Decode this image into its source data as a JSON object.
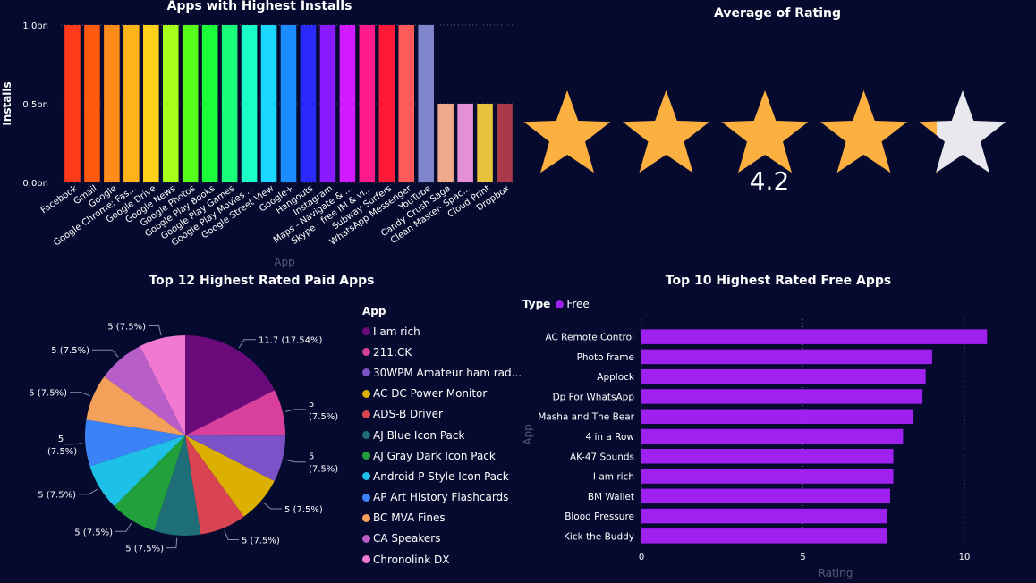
{
  "installs_chart": {
    "title": "Apps with Highest Installs",
    "xlabel": "App",
    "ylabel": "Installs",
    "ticks": [
      "0.0bn",
      "0.5bn",
      "1.0bn"
    ]
  },
  "rating_card": {
    "title": "Average of Rating",
    "value": "4.2"
  },
  "paid_chart": {
    "title": "Top 12 Highest Rated Paid Apps",
    "legend_title": "App"
  },
  "free_chart": {
    "title": "Top 10 Highest Rated Free Apps",
    "legend_label": "Type",
    "legend_entry": "Free",
    "ylabel": "App",
    "xlabel": "Rating",
    "ticks": [
      "0",
      "5",
      "10"
    ]
  },
  "chart_data": [
    {
      "type": "bar",
      "title": "Apps with Highest Installs",
      "xlabel": "App",
      "ylabel": "Installs",
      "ylim": [
        0,
        1.0
      ],
      "unit": "bn",
      "categories": [
        "Facebook",
        "Gmail",
        "Google",
        "Google Chrome: Fas...",
        "Google Drive",
        "Google News",
        "Google Photos",
        "Google Play Books",
        "Google Play Games",
        "Google Play Movies ...",
        "Google Street View",
        "Google+",
        "Hangouts",
        "Instagram",
        "Maps - Navigate & ...",
        "Skype - free IM & vi...",
        "Subway Surfers",
        "WhatsApp Messenger",
        "YouTube",
        "Candy Crush Saga",
        "Clean Master- Spac...",
        "Cloud Print",
        "Dropbox"
      ],
      "values": [
        1.0,
        1.0,
        1.0,
        1.0,
        1.0,
        1.0,
        1.0,
        1.0,
        1.0,
        1.0,
        1.0,
        1.0,
        1.0,
        1.0,
        1.0,
        1.0,
        1.0,
        1.0,
        1.0,
        0.5,
        0.5,
        0.5,
        0.5
      ],
      "colors": [
        "#ff3a1a",
        "#ff5a10",
        "#ff8c1a",
        "#ffb31a",
        "#ffd21a",
        "#a8ff1a",
        "#55ff1a",
        "#1aff3a",
        "#1aff7a",
        "#1affc8",
        "#1ad8ff",
        "#1a8cff",
        "#2a2aff",
        "#8a1aff",
        "#d21aff",
        "#ff1a8c",
        "#ff1a3a",
        "#ff5a5a",
        "#7f86cc",
        "#f0a98a",
        "#e58fd8",
        "#e8c23a",
        "#a83a4a",
        "#b8b8b8"
      ],
      "grid": true
    },
    {
      "type": "pie",
      "title": "Top 12 Highest Rated Paid Apps",
      "legend_title": "App",
      "labels": [
        "I am rich",
        "211:CK",
        "30WPM Amateur ham rad...",
        "AC DC Power Monitor",
        "ADS-B Driver",
        "AJ Blue Icon Pack",
        "AJ Gray Dark Icon Pack",
        "Android P Style Icon Pack",
        "AP Art History Flashcards",
        "BC MVA Fines",
        "CA Speakers",
        "Chronolink DX"
      ],
      "values": [
        11.7,
        5,
        5,
        5,
        5,
        5,
        5,
        5,
        5,
        5,
        5,
        5
      ],
      "data_labels": [
        "11.7 (17.54%)",
        "5 (7.5%)",
        "5 (7.5%)",
        "5 (7.5%)",
        "5 (7.5%)",
        "5 (7.5%)",
        "5 (7.5%)",
        "5 (7.5%)",
        "5 (7.5%)",
        "5 (7.5%)",
        "5 (7.5%)",
        "5 (7.5%)"
      ],
      "colors": [
        "#6b0a7a",
        "#d9409d",
        "#7b52c8",
        "#dcb000",
        "#d94452",
        "#1e6e78",
        "#22a03c",
        "#1ec0e8",
        "#3b82f6",
        "#f2a05a",
        "#b85ec8",
        "#f07ad2"
      ],
      "legend": "right"
    },
    {
      "type": "bar",
      "orientation": "horizontal",
      "title": "Top 10 Highest Rated Free Apps",
      "xlabel": "Rating",
      "ylabel": "App",
      "xlim": [
        0,
        11.0
      ],
      "legend": {
        "title": "Type",
        "entries": [
          "Free"
        ],
        "position": "top-left"
      },
      "series": [
        {
          "name": "Free",
          "color": "#a020f0"
        }
      ],
      "categories": [
        "AC Remote Control",
        "Photo frame",
        "Applock",
        "Dp For WhatsApp",
        "Masha and The Bear",
        "4 in a Row",
        "AK-47 Sounds",
        "I am rich",
        "BM Wallet",
        "Blood Pressure",
        "Kick the Buddy"
      ],
      "values": [
        10.7,
        9.0,
        8.8,
        8.7,
        8.4,
        8.1,
        7.8,
        7.8,
        7.7,
        7.6,
        7.6
      ],
      "grid": true
    }
  ]
}
